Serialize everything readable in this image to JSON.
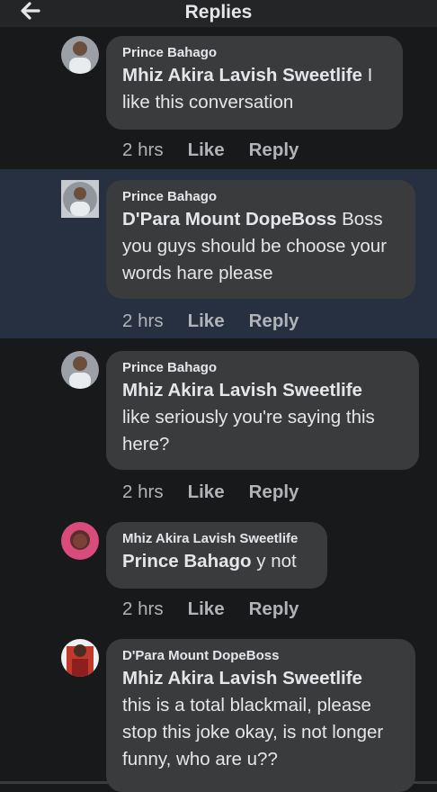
{
  "header": {
    "title": "Replies",
    "back_icon": "arrow-left-icon"
  },
  "comments": [
    {
      "author": "Prince Bahago",
      "mention": "Mhiz Akira Lavish Sweetlife",
      "text_lines": [
        " I",
        "like this conversation"
      ],
      "time": "2 hrs",
      "like": "Like",
      "reply": "Reply"
    },
    {
      "author": "Prince Bahago",
      "mention": "D'Para Mount DopeBoss",
      "text_lines": "Boss you guys should be choose your words hare please",
      "time": "2 hrs",
      "like": "Like",
      "reply": "Reply"
    },
    {
      "author": "Prince Bahago",
      "mention": "Mhiz Akira Lavish Sweetlife",
      "text_lines": "like seriously you're saying this here?",
      "time": "2 hrs",
      "like": "Like",
      "reply": "Reply"
    },
    {
      "author": "Mhiz Akira Lavish Sweetlife",
      "mention": "Prince Bahago",
      "text_lines": " y not",
      "time": "2 hrs",
      "like": "Like",
      "reply": "Reply"
    },
    {
      "author": "D'Para Mount DopeBoss",
      "mention": "Mhiz Akira Lavish Sweetlife",
      "text_lines": "this is a total blackmail, please stop this joke okay, is not longer funny, who are u??"
    }
  ]
}
